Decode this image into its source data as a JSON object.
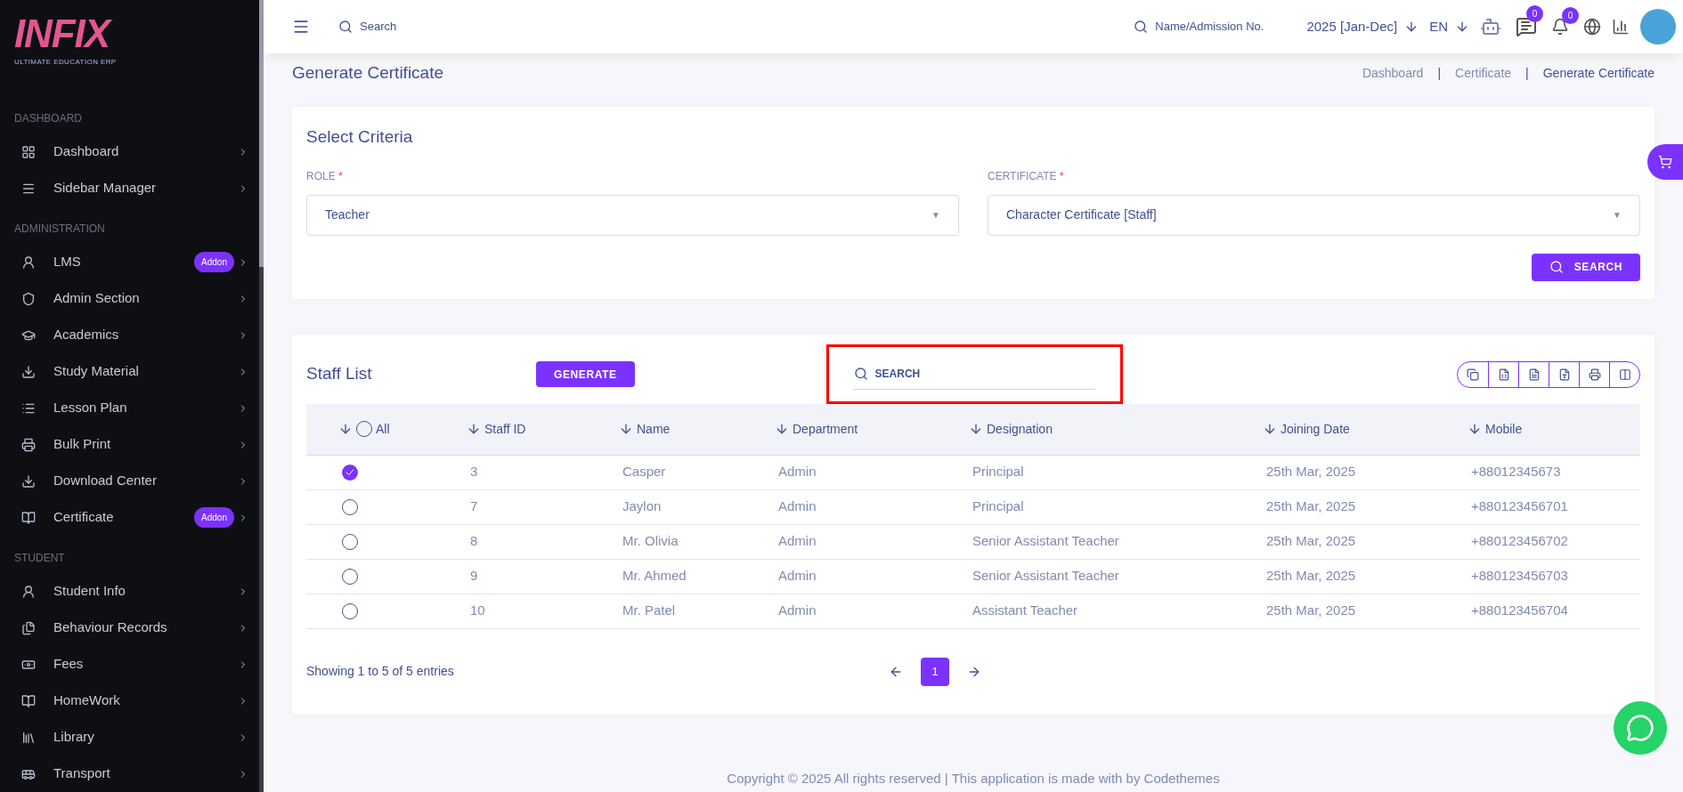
{
  "logo": {
    "name": "INFIX",
    "tagline": "ULTIMATE EDUCATION ERP"
  },
  "sidebar": {
    "sections": [
      {
        "title": "DASHBOARD",
        "items": [
          {
            "label": "Dashboard"
          },
          {
            "label": "Sidebar Manager"
          }
        ]
      },
      {
        "title": "ADMINISTRATION",
        "items": [
          {
            "label": "LMS",
            "badge": "Addon"
          },
          {
            "label": "Admin Section"
          },
          {
            "label": "Academics"
          },
          {
            "label": "Study Material"
          },
          {
            "label": "Lesson Plan"
          },
          {
            "label": "Bulk Print"
          },
          {
            "label": "Download Center"
          },
          {
            "label": "Certificate",
            "badge": "Addon"
          }
        ]
      },
      {
        "title": "STUDENT",
        "items": [
          {
            "label": "Student Info"
          },
          {
            "label": "Behaviour Records"
          },
          {
            "label": "Fees"
          },
          {
            "label": "HomeWork"
          },
          {
            "label": "Library"
          },
          {
            "label": "Transport"
          }
        ]
      }
    ]
  },
  "topbar": {
    "search_placeholder": "Search",
    "student_search": "Name/Admission No.",
    "session": "2025 [Jan-Dec]",
    "language": "EN",
    "messages_count": "0",
    "notifications_count": "0"
  },
  "page": {
    "title": "Generate Certificate",
    "breadcrumbs": [
      "Dashboard",
      "Certificate",
      "Generate Certificate"
    ],
    "breadcrumb_separators": [
      "|",
      "|"
    ]
  },
  "criteria": {
    "title": "Select Criteria",
    "fields": [
      {
        "label": "ROLE",
        "required_mark": "*",
        "value": "Teacher",
        "caret": "▼"
      },
      {
        "label": "CERTIFICATE",
        "required_mark": "*",
        "value": "Character Certificate [Staff]",
        "caret": "▼"
      }
    ],
    "search_button": "SEARCH"
  },
  "staff_list": {
    "title": "Staff List",
    "generate_button": "GENERATE",
    "search_placeholder": "SEARCH",
    "select_all": {
      "label": "All",
      "checked": false
    },
    "columns": [
      "Staff ID",
      "Name",
      "Department",
      "Designation",
      "Joining Date",
      "Mobile"
    ],
    "rows": [
      {
        "selected": true,
        "cells": [
          "3",
          "Casper",
          "Admin",
          "Principal",
          "25th Mar, 2025",
          "+88012345673"
        ]
      },
      {
        "selected": false,
        "cells": [
          "7",
          "Jaylon",
          "Admin",
          "Principal",
          "25th Mar, 2025",
          "+880123456701"
        ]
      },
      {
        "selected": false,
        "cells": [
          "8",
          "Mr. Olivia",
          "Admin",
          "Senior Assistant Teacher",
          "25th Mar, 2025",
          "+880123456702"
        ]
      },
      {
        "selected": false,
        "cells": [
          "9",
          "Mr. Ahmed",
          "Admin",
          "Senior Assistant Teacher",
          "25th Mar, 2025",
          "+880123456703"
        ]
      },
      {
        "selected": false,
        "cells": [
          "10",
          "Mr. Patel",
          "Admin",
          "Assistant Teacher",
          "25th Mar, 2025",
          "+880123456704"
        ]
      }
    ],
    "entries_info": "Showing 1 to 5 of 5 entries",
    "pages": [
      {
        "label": "1",
        "selected": true
      }
    ]
  },
  "footer": "Copyright © 2025 All rights reserved | This application is made with by Codethemes"
}
